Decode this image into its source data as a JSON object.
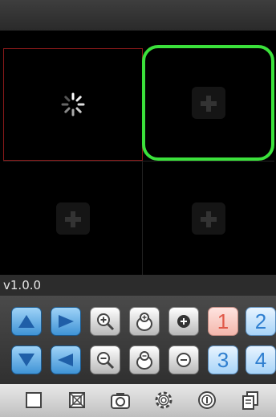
{
  "camera_grid": {
    "cells": [
      {
        "state": "loading",
        "icon": "loading-spinner-icon",
        "border_color": "#8a1a1a"
      },
      {
        "state": "empty-selected",
        "icon": "add-camera-icon",
        "border_color": "#3be13b"
      },
      {
        "state": "empty",
        "icon": "add-camera-icon"
      },
      {
        "state": "empty",
        "icon": "add-camera-icon"
      }
    ]
  },
  "version": "v1.0.0",
  "ptz_controls": {
    "row1": [
      {
        "icon": "arrow-up-icon"
      },
      {
        "icon": "arrow-right-icon"
      },
      {
        "icon": "zoom-in-icon"
      },
      {
        "icon": "focus-in-icon"
      },
      {
        "icon": "iris-open-icon"
      },
      {
        "label": "1",
        "active": true
      },
      {
        "label": "2"
      }
    ],
    "row2": [
      {
        "icon": "arrow-down-icon"
      },
      {
        "icon": "arrow-left-icon"
      },
      {
        "icon": "zoom-out-icon"
      },
      {
        "icon": "focus-out-icon"
      },
      {
        "icon": "iris-close-icon"
      },
      {
        "label": "3"
      },
      {
        "label": "4"
      }
    ]
  },
  "toolbar": [
    {
      "icon": "single-view-icon"
    },
    {
      "icon": "quad-view-icon"
    },
    {
      "icon": "snapshot-camera-icon"
    },
    {
      "icon": "settings-gear-icon"
    },
    {
      "icon": "info-icon"
    },
    {
      "icon": "files-icon"
    }
  ],
  "colors": {
    "selected_border": "#3be13b",
    "active_border": "#8a1a1a",
    "button_blue": "#3f93d6",
    "active_channel": "#e05848"
  }
}
